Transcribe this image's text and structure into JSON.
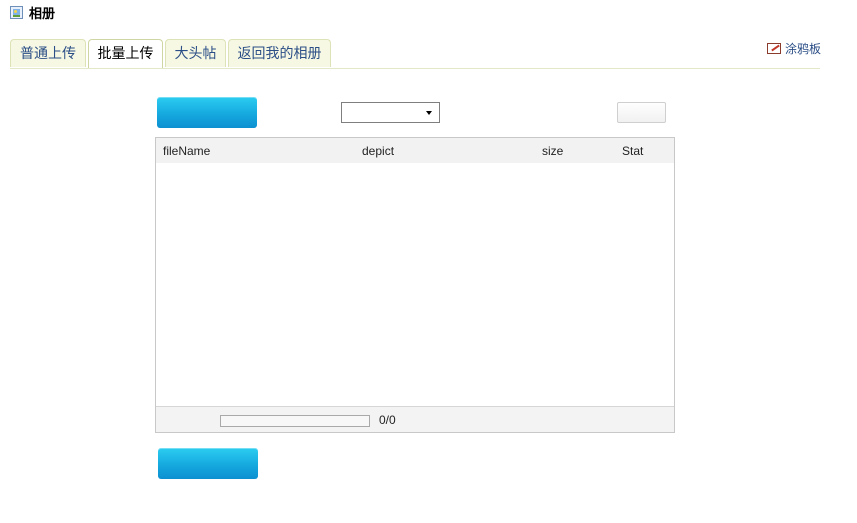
{
  "header": {
    "title": "相册",
    "icon": "album-icon"
  },
  "tabs": [
    {
      "label": "普通上传",
      "active": false
    },
    {
      "label": "批量上传",
      "active": true
    },
    {
      "label": "大头帖",
      "active": false
    },
    {
      "label": "返回我的相册",
      "active": false
    }
  ],
  "doodle": {
    "label": "涂鸦板",
    "icon": "pencil-icon"
  },
  "select": {
    "value": ""
  },
  "grid": {
    "columns": [
      "fileName",
      "depict",
      "size",
      "Stat"
    ],
    "rows": []
  },
  "footer": {
    "progress": 0,
    "count_text": "0/0"
  },
  "colors": {
    "accent": "#15a9df",
    "link": "#2b4e86",
    "tab_bg": "#f6f8e4"
  }
}
